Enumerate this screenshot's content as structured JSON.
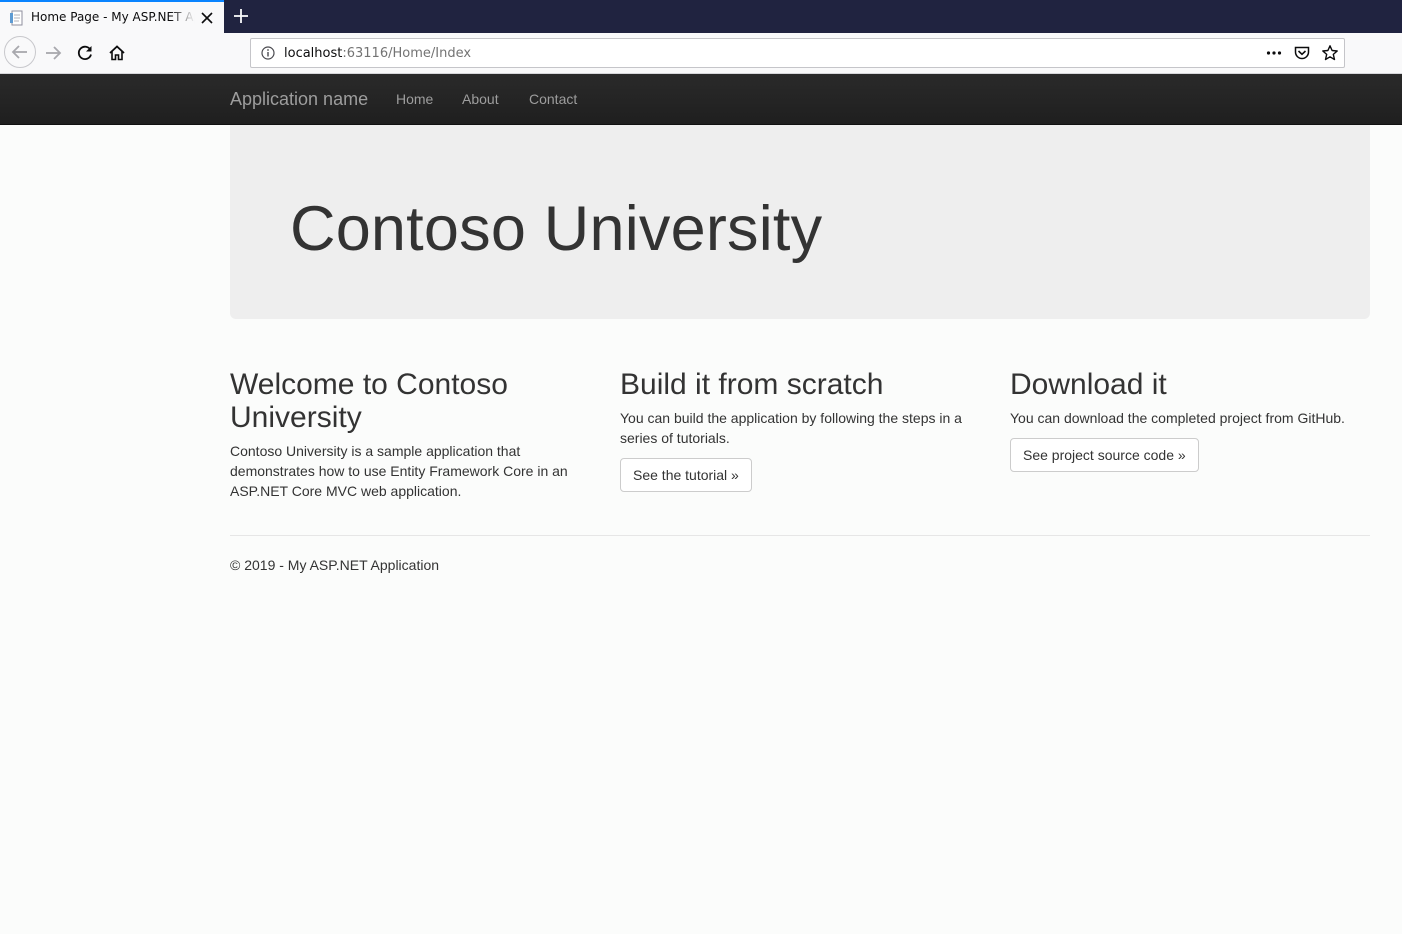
{
  "browser": {
    "tab": {
      "title": "Home Page - My ASP.NET Application"
    },
    "url": {
      "host": "localhost",
      "path": ":63116/Home/Index"
    }
  },
  "navbar": {
    "brand": "Application name",
    "links": [
      "Home",
      "About",
      "Contact"
    ]
  },
  "jumbotron": {
    "title": "Contoso University"
  },
  "columns": [
    {
      "heading": "Welcome to Contoso University",
      "text": "Contoso University is a sample application that demonstrates how to use Entity Framework Core in an ASP.NET Core MVC web application."
    },
    {
      "heading": "Build it from scratch",
      "text": "You can build the application by following the steps in a series of tutorials.",
      "button": "See the tutorial »"
    },
    {
      "heading": "Download it",
      "text": "You can download the completed project from GitHub.",
      "button": "See project source code »"
    }
  ],
  "footer": {
    "text": "© 2019 - My ASP.NET Application"
  },
  "colors": {
    "tab_strip": "#202340",
    "tab_accent": "#0a84ff",
    "navbar": "#222222",
    "nav_text": "#9d9d9d",
    "jumbotron": "#eeeeee",
    "text": "#333333"
  },
  "icons": [
    "page-favicon-icon",
    "close-icon",
    "plus-icon",
    "back-arrow-icon",
    "forward-arrow-icon",
    "reload-icon",
    "home-icon",
    "info-icon",
    "more-dots-icon",
    "pocket-icon",
    "star-icon"
  ]
}
